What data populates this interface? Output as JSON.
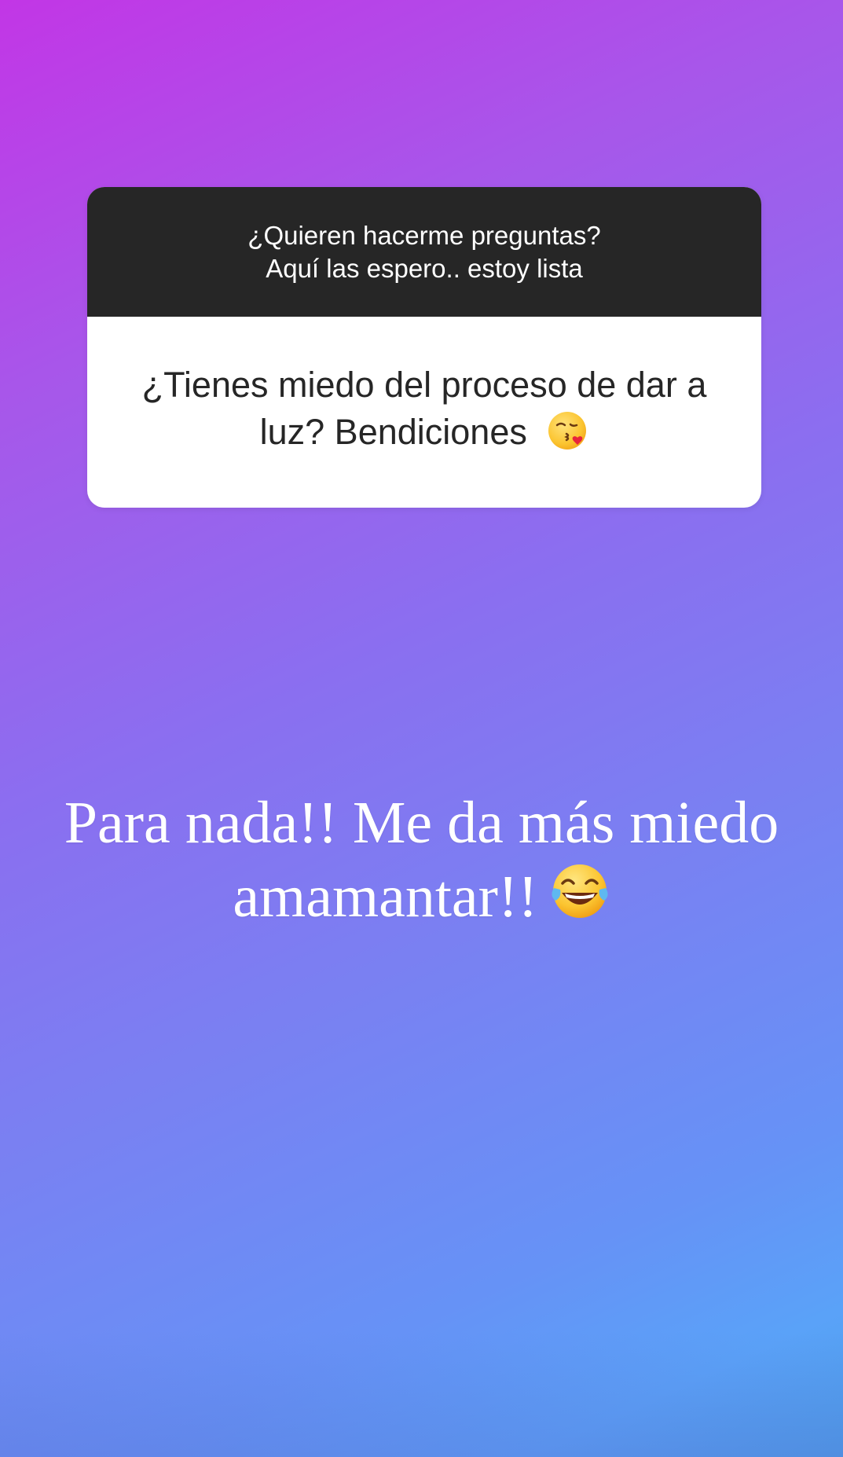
{
  "question_sticker": {
    "prompt_line1": "¿Quieren hacerme preguntas?",
    "prompt_line2": "Aquí las espero.. estoy lista",
    "question_text": "¿Tienes miedo del proceso de dar a luz? Bendiciones",
    "question_emoji": "face-throwing-kiss-icon"
  },
  "answer": {
    "line1": "Para nada!! Me da más miedo",
    "line2": "amamantar!!",
    "emoji": "face-with-tears-of-joy-icon"
  },
  "colors": {
    "gradient_top": "#c236e6",
    "gradient_bottom": "#5aa2f8",
    "card_header": "#262626",
    "card_body": "#ffffff"
  }
}
